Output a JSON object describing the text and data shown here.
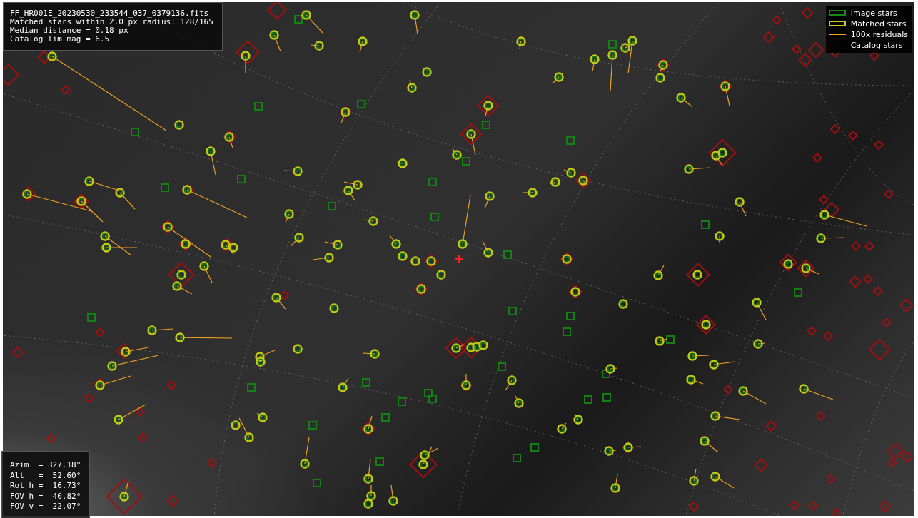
{
  "info_box": {
    "lines": [
      "FF_HR001E_20230530_233544_037_0379136.fits",
      "Matched stars within 2.0 px radius: 128/165",
      "Median distance = 0.18 px",
      "Catalog lim mag = 6.5"
    ]
  },
  "legend": {
    "items": [
      {
        "label": "Image stars",
        "kind": "image"
      },
      {
        "label": "Matched stars",
        "kind": "matched"
      },
      {
        "label": "100x residuals",
        "kind": "residual"
      },
      {
        "label": "Catalog stars",
        "kind": "catalog"
      }
    ]
  },
  "pointing_box": {
    "lines": [
      "Azim  = 327.18°",
      "Alt   =  52.60°",
      "Rot h =  16.73°",
      "FOV h =  40.82°",
      "FOV v =  22.07°"
    ]
  }
}
